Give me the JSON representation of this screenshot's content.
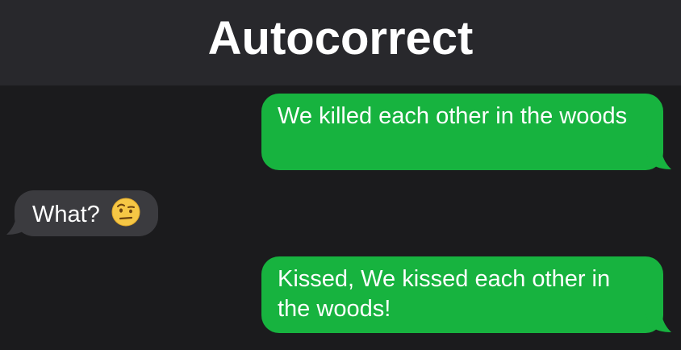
{
  "title": "Autocorrect",
  "messages": [
    {
      "direction": "sent",
      "text": "We killed each other in the woods"
    },
    {
      "direction": "received",
      "text": "What?",
      "emoji": "face-with-raised-eyebrow-icon"
    },
    {
      "direction": "sent",
      "text": "Kissed, We kissed each other in the woods!"
    }
  ],
  "colors": {
    "title_bar": "#28282c",
    "background": "#1b1b1d",
    "sent_bubble": "#17b33f",
    "received_bubble": "#3b3b3f",
    "text": "#ffffff"
  }
}
